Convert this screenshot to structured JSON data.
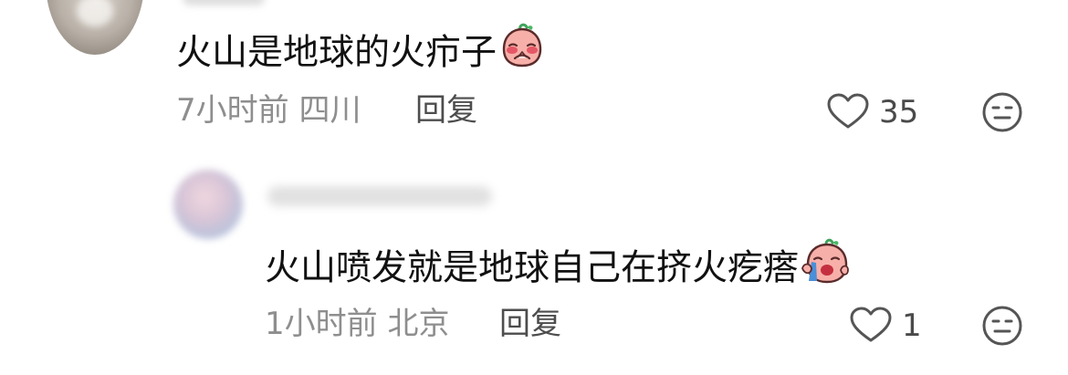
{
  "colors": {
    "text_primary": "#111111",
    "text_meta": "#8e8e8e",
    "text_action": "#4d4d4d",
    "icon_stroke": "#555555",
    "emoji_skin": "#f7b0a9",
    "emoji_blush": "#e2485a"
  },
  "comments": [
    {
      "text": "火山是地球的火疖子",
      "emoji": "blush-emoji",
      "time": "7小时前",
      "location": "四川",
      "reply_label": "回复",
      "like_count": "35",
      "like_icon": "heart-outline-icon",
      "more_icon": "neutral-face-icon"
    },
    {
      "text": "火山喷发就是地球自己在挤火疙瘩",
      "emoji": "crying-emoji",
      "time": "1小时前",
      "location": "北京",
      "reply_label": "回复",
      "like_count": "1",
      "like_icon": "heart-outline-icon",
      "more_icon": "neutral-face-icon"
    }
  ]
}
